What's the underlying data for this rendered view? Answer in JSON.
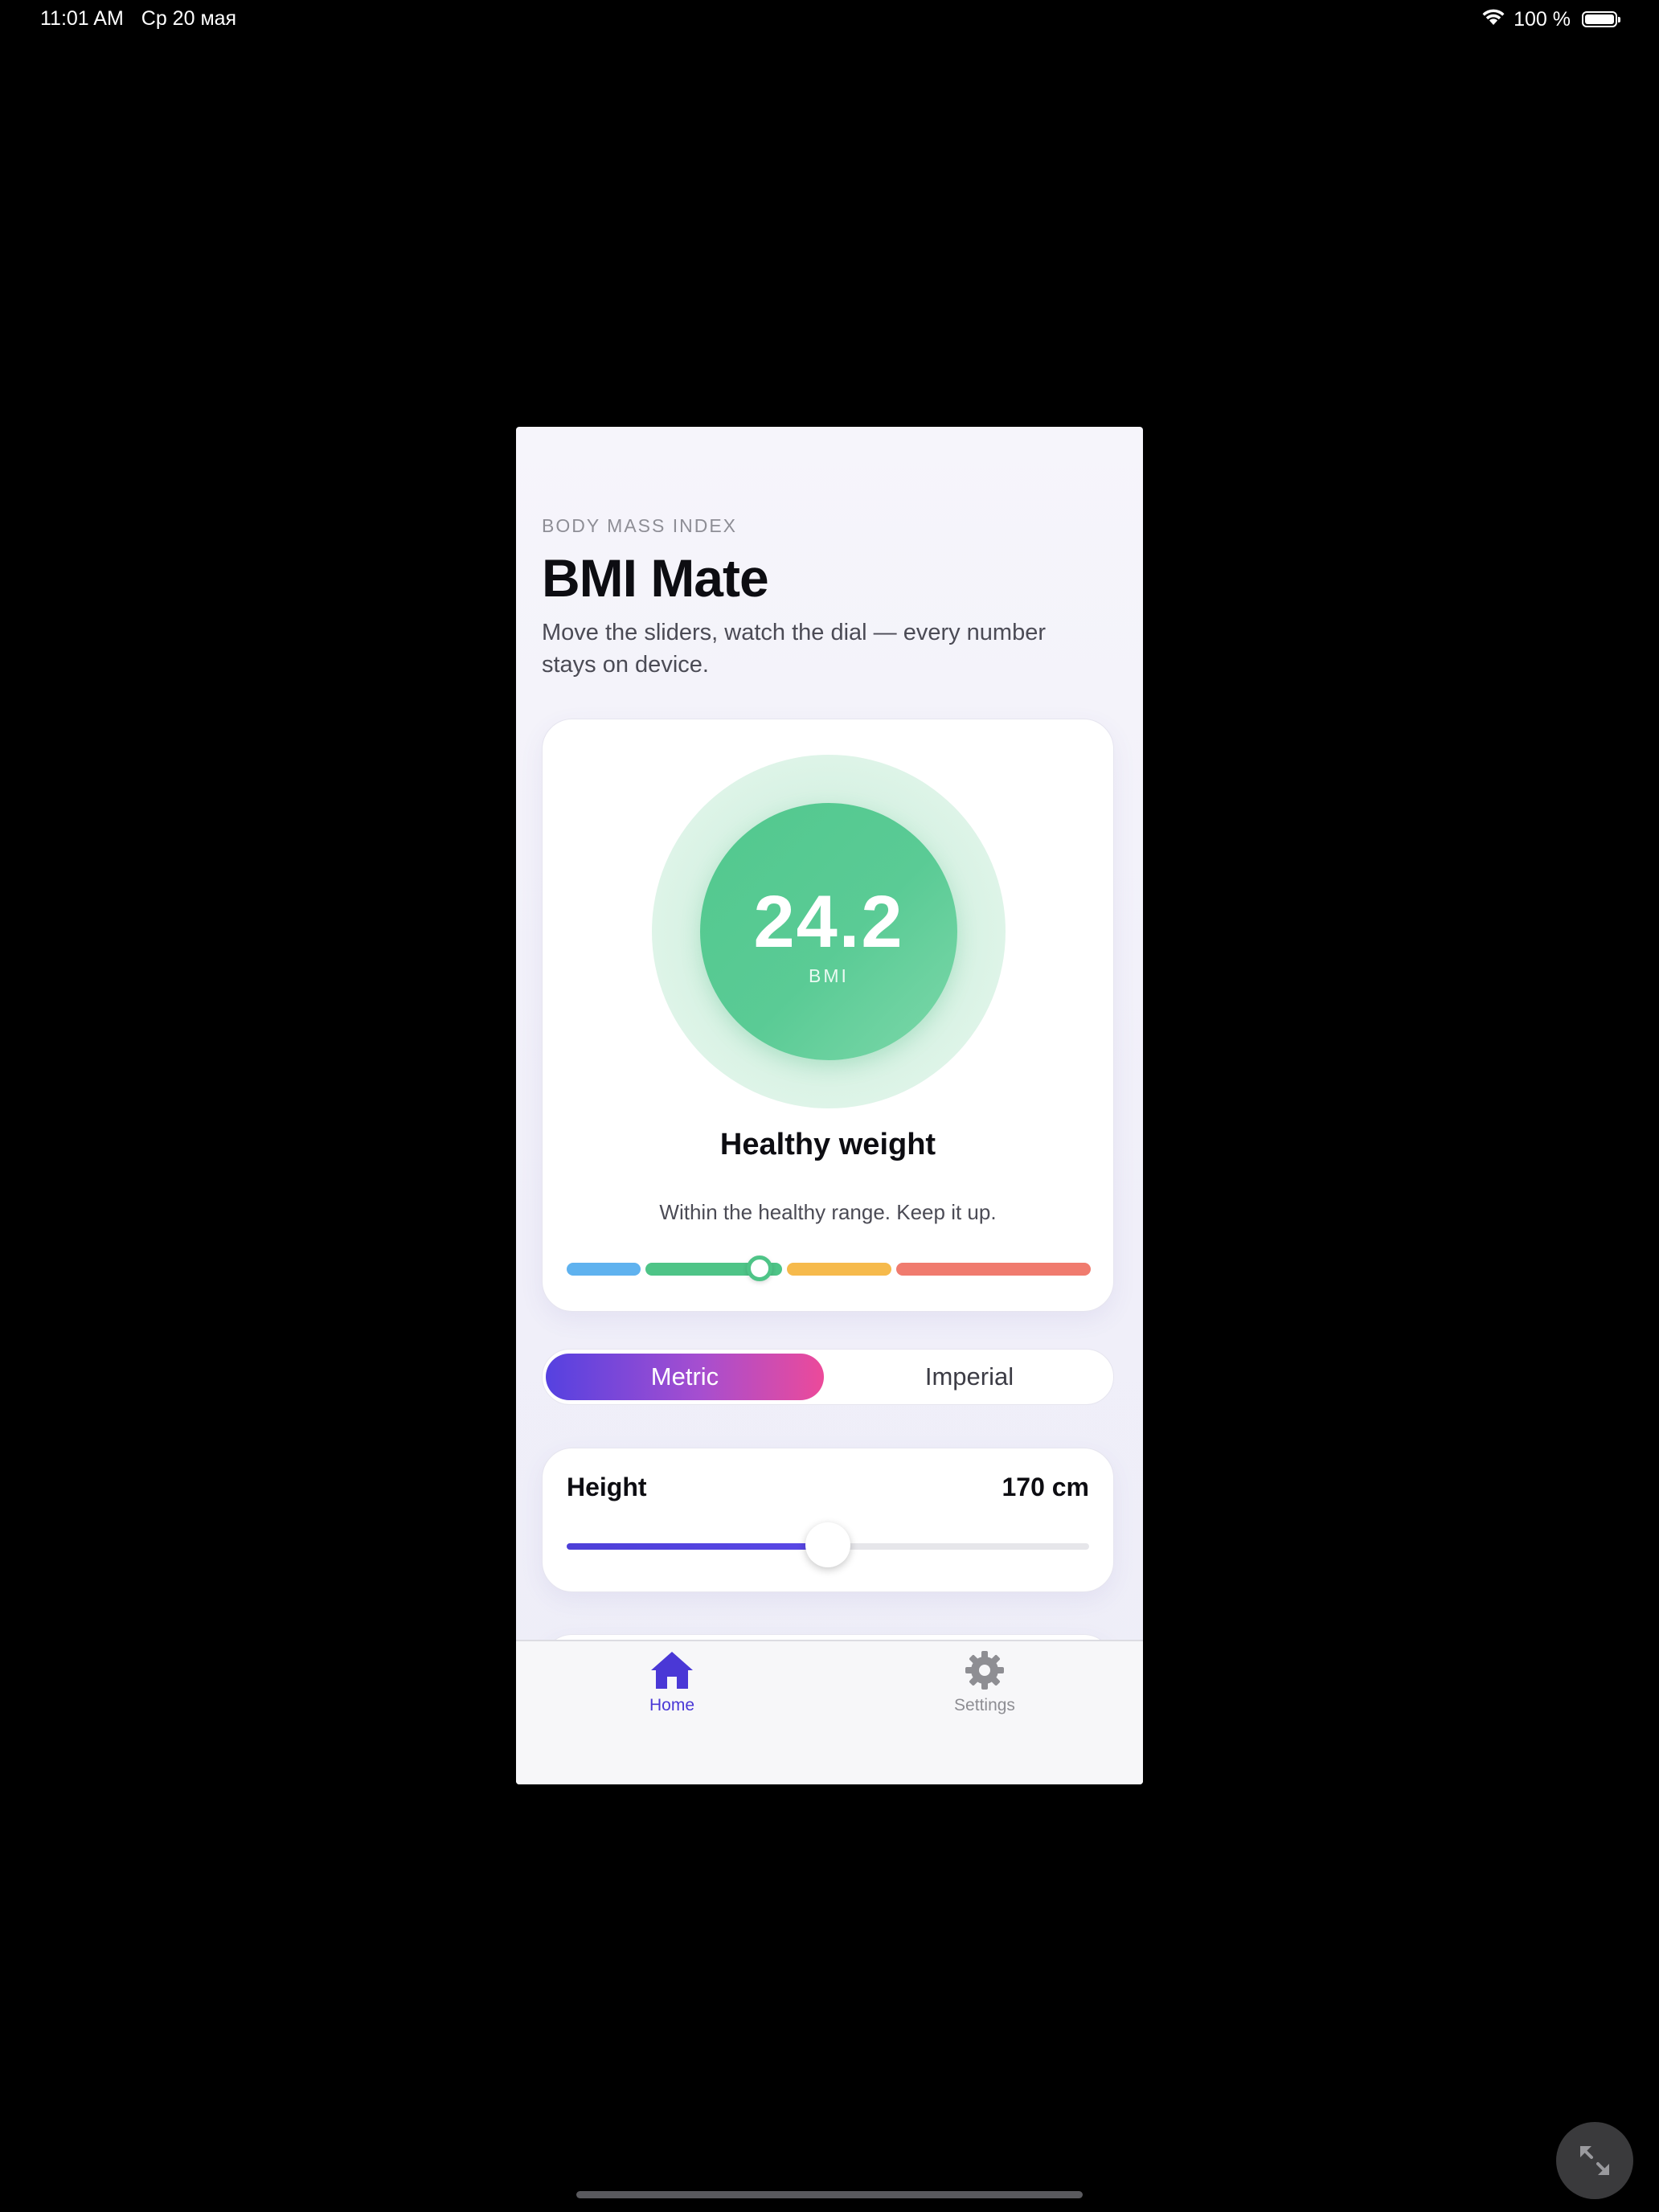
{
  "status_bar": {
    "time": "11:01 AM",
    "date": "Ср 20 мая",
    "battery_text": "100 %",
    "battery_level": 1.0
  },
  "header": {
    "eyebrow": "BODY MASS INDEX",
    "title": "BMI Mate",
    "subtitle": "Move the sliders, watch the dial — every number stays on device."
  },
  "result": {
    "bmi_value": "24.2",
    "bmi_label": "BMI",
    "category": "Healthy weight",
    "message": "Within the healthy range. Keep it up.",
    "dial_color": "#52c88e",
    "scale_segments": [
      {
        "name": "underweight",
        "color": "#5fb2ef"
      },
      {
        "name": "healthy",
        "color": "#4ec487"
      },
      {
        "name": "overweight",
        "color": "#f6ba4c"
      },
      {
        "name": "obese",
        "color": "#f07b6e"
      }
    ]
  },
  "units": {
    "options": [
      "Metric",
      "Imperial"
    ],
    "selected": "Metric"
  },
  "height": {
    "label": "Height",
    "value_text": "170 cm",
    "value": 170,
    "slider_fraction": 0.5
  },
  "tab_bar": {
    "items": [
      {
        "label": "Home",
        "icon": "house-icon",
        "active": true
      },
      {
        "label": "Settings",
        "icon": "gear-icon",
        "active": false
      }
    ],
    "accent": "#4a38d6"
  }
}
